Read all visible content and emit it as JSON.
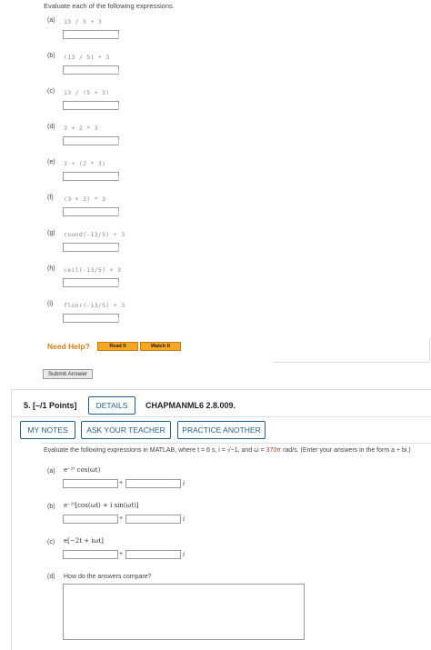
{
  "intro_text": "Evaluate each of the following expressions.",
  "parts": [
    {
      "letter": "(a)",
      "expr": "13 / 5 + 3"
    },
    {
      "letter": "(b)",
      "expr": "(13 / 5) + 3"
    },
    {
      "letter": "(c)",
      "expr": "13 / (5 + 3)"
    },
    {
      "letter": "(d)",
      "expr": "3 + 2 * 3"
    },
    {
      "letter": "(e)",
      "expr": "3 + (2 * 3)"
    },
    {
      "letter": "(f)",
      "expr": "(3 + 2) * 3"
    },
    {
      "letter": "(g)",
      "expr": "round(-13/5) + 3"
    },
    {
      "letter": "(h)",
      "expr": "ceil(-13/5) + 3"
    },
    {
      "letter": "(i)",
      "expr": "floor(-13/5) + 3"
    }
  ],
  "need_help": "Need Help?",
  "read_it": "Read It",
  "watch_it": "Watch It",
  "submit_answer": "Submit Answer",
  "question5": {
    "title": "5.  [–/1 Points]",
    "details": "DETAILS",
    "code": "CHAPMANML6 2.8.009.",
    "my_notes": "MY NOTES",
    "ask_teacher": "ASK YOUR TEACHER",
    "practice": "PRACTICE ANOTHER",
    "prompt_start": "Evaluate the following expressions in MATLAB, where t = 6 s, i = ",
    "prompt_sqrt": "√−1",
    "prompt_mid": ", and ω = ",
    "prompt_red": "370π",
    "prompt_end": " rad/s. (Enter your answers in the form a + bi.)",
    "sub": [
      {
        "letter": "(a)",
        "math": "e⁻²ᵗ cos(ωt)"
      },
      {
        "letter": "(b)",
        "math": "e⁻²ᵗ[cos(ωt) + i sin(ωt)]"
      },
      {
        "letter": "(c)",
        "math": "e[−2t + iωt]"
      },
      {
        "letter": "(d)",
        "math": "How do the answers compare?"
      }
    ],
    "plus": "+",
    "i_unit": "i"
  },
  "colors": {
    "accent": "#1f5f93",
    "help_orange": "#e07a10",
    "button_orange": "#f5a623",
    "red_value": "#c0392b"
  }
}
